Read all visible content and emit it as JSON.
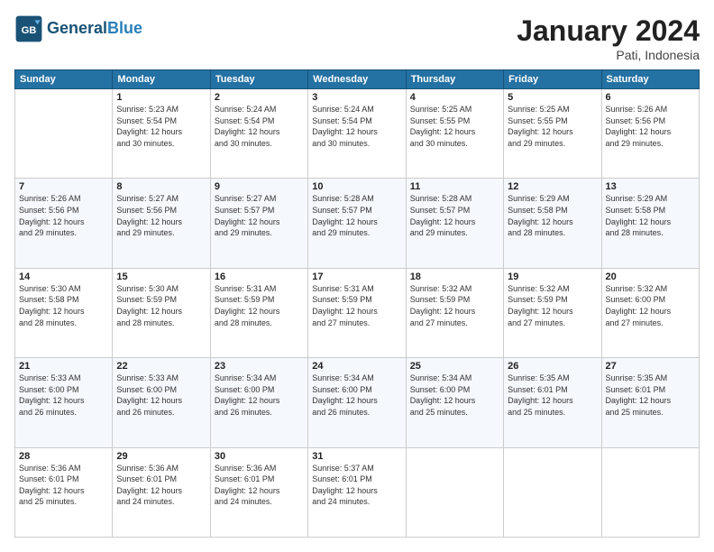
{
  "header": {
    "logo_line1": "General",
    "logo_line2": "Blue",
    "month": "January 2024",
    "location": "Pati, Indonesia"
  },
  "days_of_week": [
    "Sunday",
    "Monday",
    "Tuesday",
    "Wednesday",
    "Thursday",
    "Friday",
    "Saturday"
  ],
  "weeks": [
    [
      {
        "num": "",
        "info": ""
      },
      {
        "num": "1",
        "info": "Sunrise: 5:23 AM\nSunset: 5:54 PM\nDaylight: 12 hours\nand 30 minutes."
      },
      {
        "num": "2",
        "info": "Sunrise: 5:24 AM\nSunset: 5:54 PM\nDaylight: 12 hours\nand 30 minutes."
      },
      {
        "num": "3",
        "info": "Sunrise: 5:24 AM\nSunset: 5:54 PM\nDaylight: 12 hours\nand 30 minutes."
      },
      {
        "num": "4",
        "info": "Sunrise: 5:25 AM\nSunset: 5:55 PM\nDaylight: 12 hours\nand 30 minutes."
      },
      {
        "num": "5",
        "info": "Sunrise: 5:25 AM\nSunset: 5:55 PM\nDaylight: 12 hours\nand 29 minutes."
      },
      {
        "num": "6",
        "info": "Sunrise: 5:26 AM\nSunset: 5:56 PM\nDaylight: 12 hours\nand 29 minutes."
      }
    ],
    [
      {
        "num": "7",
        "info": "Sunrise: 5:26 AM\nSunset: 5:56 PM\nDaylight: 12 hours\nand 29 minutes."
      },
      {
        "num": "8",
        "info": "Sunrise: 5:27 AM\nSunset: 5:56 PM\nDaylight: 12 hours\nand 29 minutes."
      },
      {
        "num": "9",
        "info": "Sunrise: 5:27 AM\nSunset: 5:57 PM\nDaylight: 12 hours\nand 29 minutes."
      },
      {
        "num": "10",
        "info": "Sunrise: 5:28 AM\nSunset: 5:57 PM\nDaylight: 12 hours\nand 29 minutes."
      },
      {
        "num": "11",
        "info": "Sunrise: 5:28 AM\nSunset: 5:57 PM\nDaylight: 12 hours\nand 29 minutes."
      },
      {
        "num": "12",
        "info": "Sunrise: 5:29 AM\nSunset: 5:58 PM\nDaylight: 12 hours\nand 28 minutes."
      },
      {
        "num": "13",
        "info": "Sunrise: 5:29 AM\nSunset: 5:58 PM\nDaylight: 12 hours\nand 28 minutes."
      }
    ],
    [
      {
        "num": "14",
        "info": "Sunrise: 5:30 AM\nSunset: 5:58 PM\nDaylight: 12 hours\nand 28 minutes."
      },
      {
        "num": "15",
        "info": "Sunrise: 5:30 AM\nSunset: 5:59 PM\nDaylight: 12 hours\nand 28 minutes."
      },
      {
        "num": "16",
        "info": "Sunrise: 5:31 AM\nSunset: 5:59 PM\nDaylight: 12 hours\nand 28 minutes."
      },
      {
        "num": "17",
        "info": "Sunrise: 5:31 AM\nSunset: 5:59 PM\nDaylight: 12 hours\nand 27 minutes."
      },
      {
        "num": "18",
        "info": "Sunrise: 5:32 AM\nSunset: 5:59 PM\nDaylight: 12 hours\nand 27 minutes."
      },
      {
        "num": "19",
        "info": "Sunrise: 5:32 AM\nSunset: 5:59 PM\nDaylight: 12 hours\nand 27 minutes."
      },
      {
        "num": "20",
        "info": "Sunrise: 5:32 AM\nSunset: 6:00 PM\nDaylight: 12 hours\nand 27 minutes."
      }
    ],
    [
      {
        "num": "21",
        "info": "Sunrise: 5:33 AM\nSunset: 6:00 PM\nDaylight: 12 hours\nand 26 minutes."
      },
      {
        "num": "22",
        "info": "Sunrise: 5:33 AM\nSunset: 6:00 PM\nDaylight: 12 hours\nand 26 minutes."
      },
      {
        "num": "23",
        "info": "Sunrise: 5:34 AM\nSunset: 6:00 PM\nDaylight: 12 hours\nand 26 minutes."
      },
      {
        "num": "24",
        "info": "Sunrise: 5:34 AM\nSunset: 6:00 PM\nDaylight: 12 hours\nand 26 minutes."
      },
      {
        "num": "25",
        "info": "Sunrise: 5:34 AM\nSunset: 6:00 PM\nDaylight: 12 hours\nand 25 minutes."
      },
      {
        "num": "26",
        "info": "Sunrise: 5:35 AM\nSunset: 6:01 PM\nDaylight: 12 hours\nand 25 minutes."
      },
      {
        "num": "27",
        "info": "Sunrise: 5:35 AM\nSunset: 6:01 PM\nDaylight: 12 hours\nand 25 minutes."
      }
    ],
    [
      {
        "num": "28",
        "info": "Sunrise: 5:36 AM\nSunset: 6:01 PM\nDaylight: 12 hours\nand 25 minutes."
      },
      {
        "num": "29",
        "info": "Sunrise: 5:36 AM\nSunset: 6:01 PM\nDaylight: 12 hours\nand 24 minutes."
      },
      {
        "num": "30",
        "info": "Sunrise: 5:36 AM\nSunset: 6:01 PM\nDaylight: 12 hours\nand 24 minutes."
      },
      {
        "num": "31",
        "info": "Sunrise: 5:37 AM\nSunset: 6:01 PM\nDaylight: 12 hours\nand 24 minutes."
      },
      {
        "num": "",
        "info": ""
      },
      {
        "num": "",
        "info": ""
      },
      {
        "num": "",
        "info": ""
      }
    ]
  ]
}
